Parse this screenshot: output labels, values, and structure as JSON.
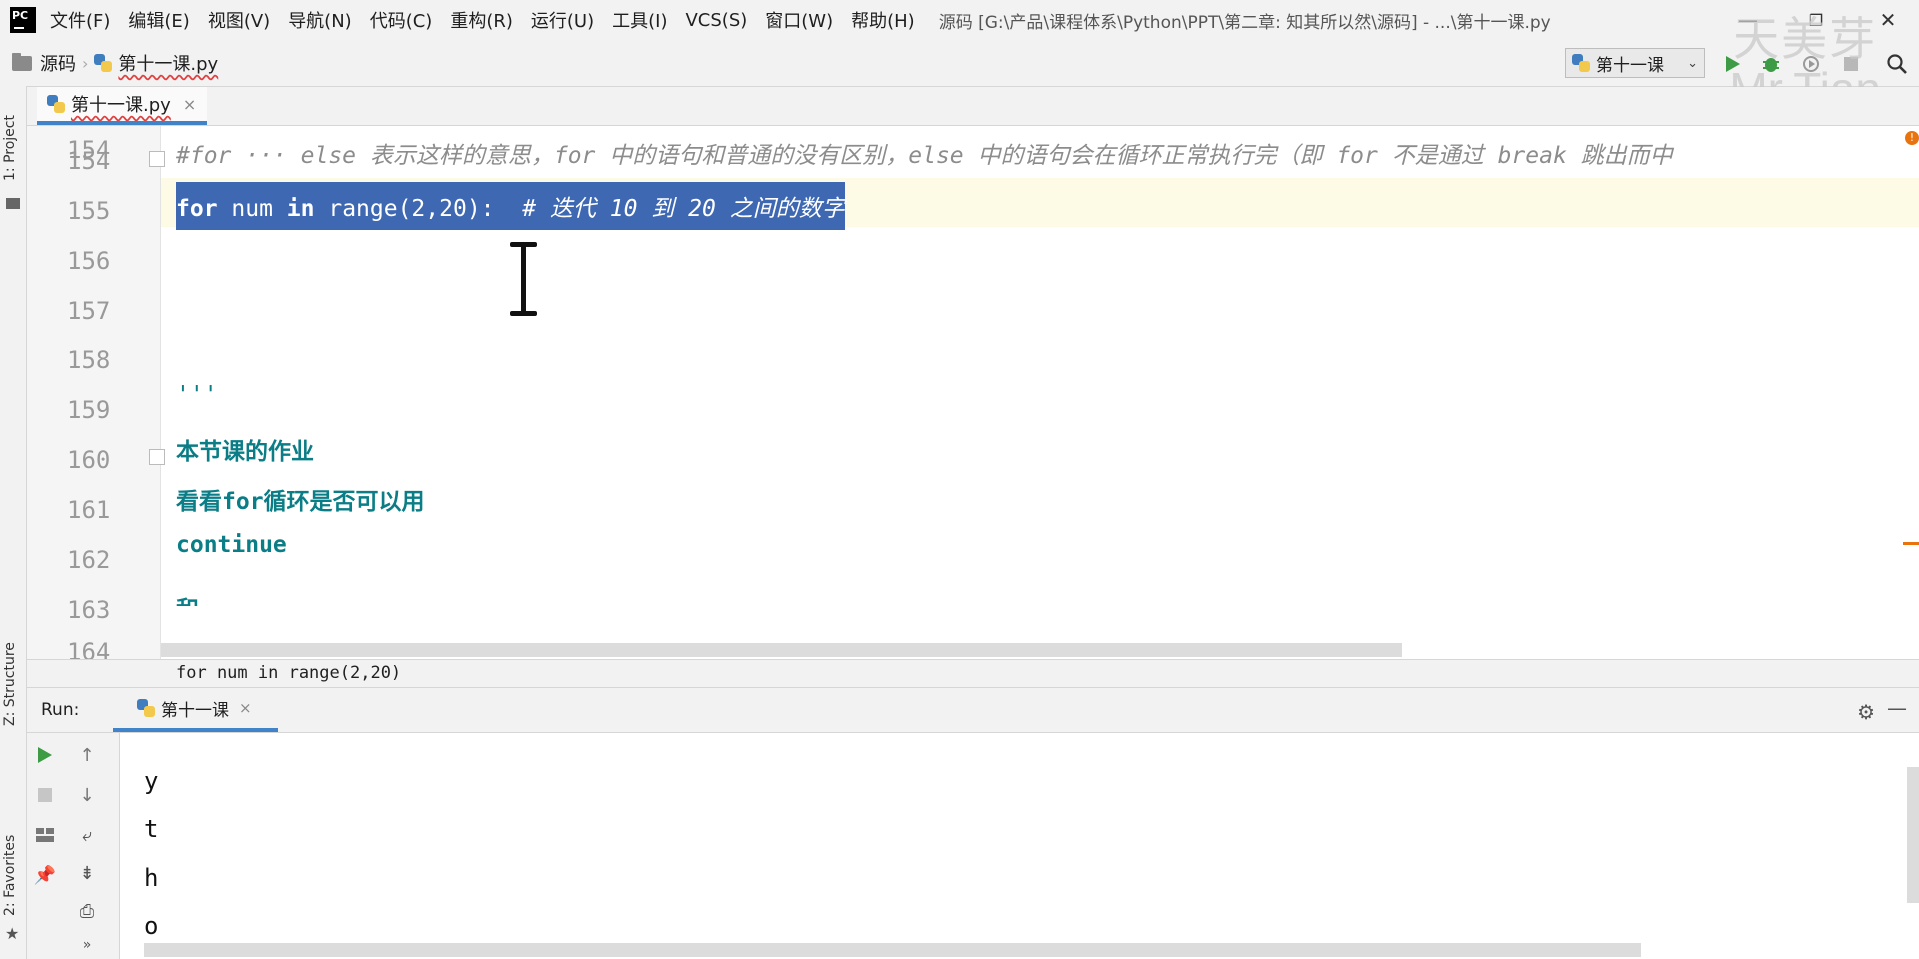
{
  "app": {
    "logo_text": "PC"
  },
  "menu": [
    "文件(F)",
    "编辑(E)",
    "视图(V)",
    "导航(N)",
    "代码(C)",
    "重构(R)",
    "运行(U)",
    "工具(I)",
    "VCS(S)",
    "窗口(W)",
    "帮助(H)"
  ],
  "window_title": "源码 [G:\\产品\\课程体系\\Python\\PPT\\第二章: 知其所以然\\源码] - ...\\第十一课.py",
  "window_controls": {
    "minimize": "—",
    "restore": "❐",
    "close": "✕"
  },
  "watermark": {
    "cn": "天美芽",
    "en": "Mr.Tian"
  },
  "breadcrumb": {
    "folder": "源码",
    "file": "第十一课.py"
  },
  "run_config": {
    "name": "第十一课"
  },
  "side_tools": {
    "project": "1: Project",
    "structure": "Z: Structure",
    "favorites": "2: Favorites"
  },
  "editor_tab": {
    "label": "第十一课.py",
    "close": "×"
  },
  "lines": [
    {
      "num": "154",
      "text": "#for ··· else 表示这样的意思，for 中的语句和普通的没有区别，else 中的语句会在循环正常执行完（即 for 不是通过 break 跳出而中"
    },
    {
      "num": "155",
      "kw1": "for",
      "mid1": " num ",
      "kw2": "in",
      "mid2": " range(2,20):  ",
      "comment": "# 迭代 10 到 20 之间的数字"
    },
    {
      "num": "156",
      "text": ""
    },
    {
      "num": "157",
      "text": ""
    },
    {
      "num": "158",
      "text": ""
    },
    {
      "num": "159",
      "text": ""
    },
    {
      "num": "160",
      "text": "'''"
    },
    {
      "num": "161",
      "text": "本节课的作业"
    },
    {
      "num": "162",
      "text": "看看for循环是否可以用"
    },
    {
      "num": "163",
      "text": "continue"
    },
    {
      "num": "164",
      "text": "和"
    }
  ],
  "code_breadcrumb": "for num in range(2,20)",
  "run_panel": {
    "label": "Run:",
    "tab": "第十一课",
    "close": "×"
  },
  "console_output": [
    "y",
    "t",
    "h",
    "o"
  ],
  "colors": {
    "accent": "#4083c9",
    "selection": "#3f68b2",
    "current_line": "#fdfbe6",
    "docstring": "#0a7d86",
    "keyword": "#000080",
    "comment": "#8c8c8c",
    "warning": "#e8730f"
  }
}
